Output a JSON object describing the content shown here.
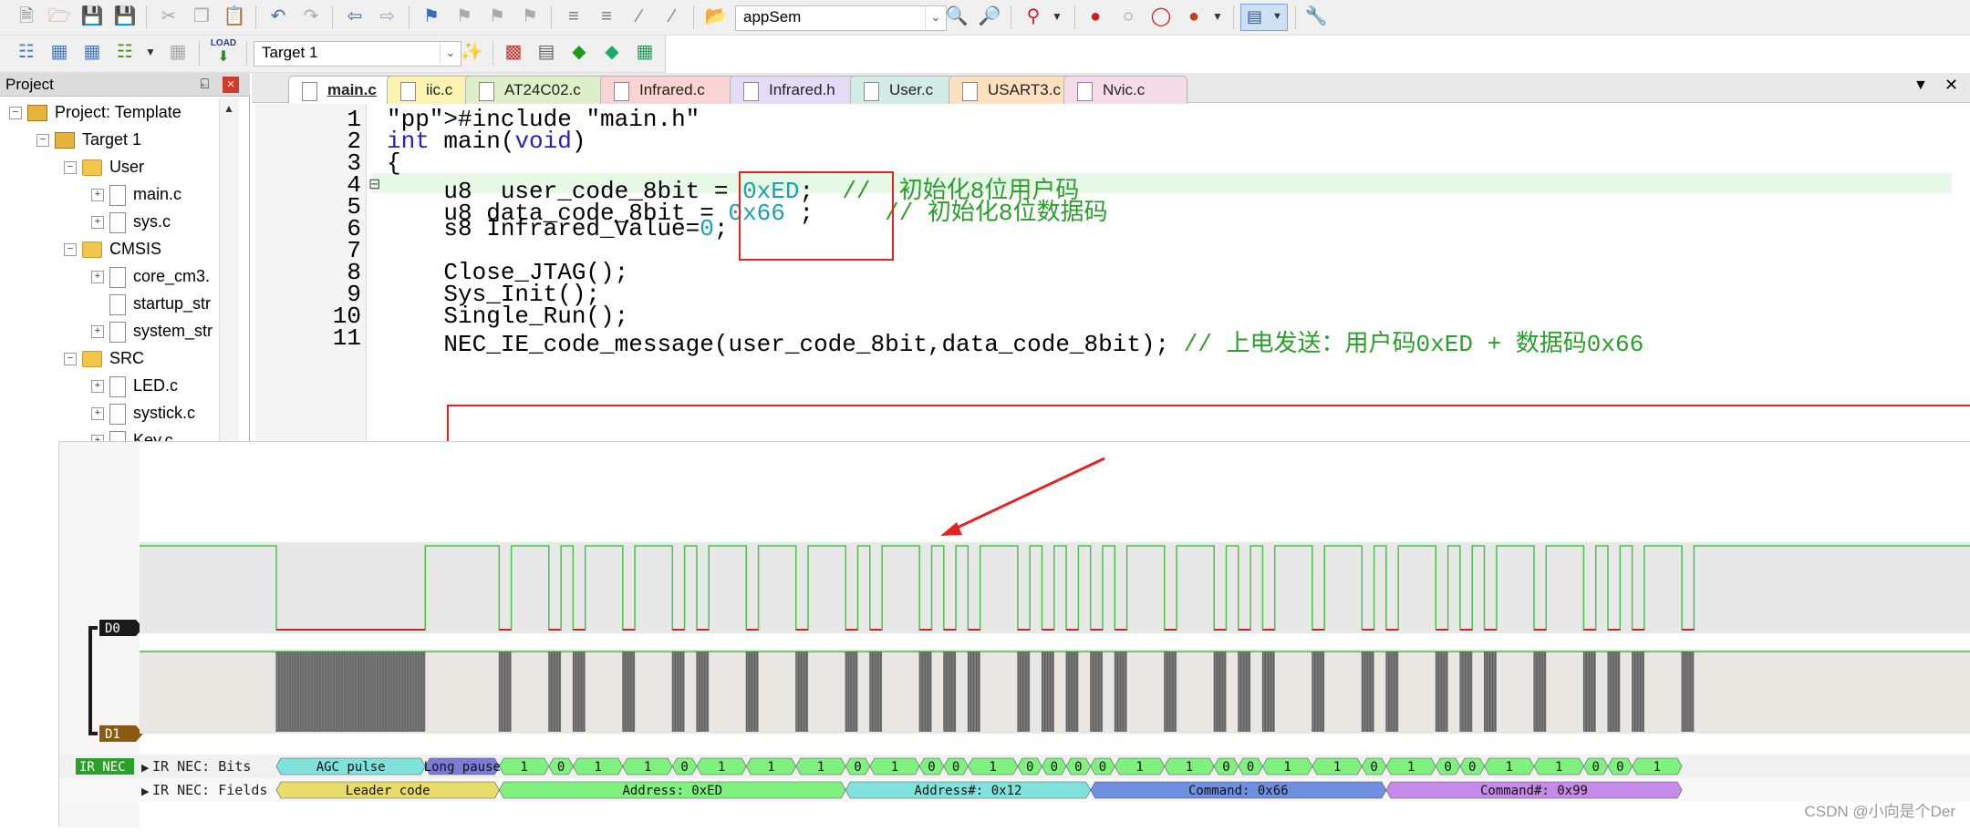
{
  "toolbar1": {
    "search_value": "appSem"
  },
  "toolbar2": {
    "target_value": "Target 1",
    "load_label": "LOAD"
  },
  "project": {
    "title": "Project",
    "pin": "⍇",
    "close": "×",
    "tree": [
      {
        "label": "Project: Template",
        "expander": "−",
        "icon": "project"
      },
      {
        "label": "Target 1",
        "expander": "−",
        "icon": "target"
      },
      {
        "label": "User",
        "expander": "−",
        "icon": "folder"
      },
      {
        "label": "main.c",
        "expander": "+",
        "icon": "file"
      },
      {
        "label": "sys.c",
        "expander": "+",
        "icon": "file"
      },
      {
        "label": "CMSIS",
        "expander": "−",
        "icon": "folder"
      },
      {
        "label": "core_cm3.",
        "expander": "+",
        "icon": "file"
      },
      {
        "label": "startup_str",
        "expander": "",
        "icon": "file"
      },
      {
        "label": "system_str",
        "expander": "+",
        "icon": "file"
      },
      {
        "label": "SRC",
        "expander": "−",
        "icon": "folder"
      },
      {
        "label": "LED.c",
        "expander": "+",
        "icon": "file"
      },
      {
        "label": "systick.c",
        "expander": "+",
        "icon": "file"
      },
      {
        "label": "Key.c",
        "expander": "+",
        "icon": "file"
      }
    ]
  },
  "tabs": [
    {
      "label": "main.c",
      "color": "#f6f6f6",
      "active": true
    },
    {
      "label": "iic.c",
      "color": "#fdf3b0"
    },
    {
      "label": "AT24C02.c",
      "color": "#dff0c8"
    },
    {
      "label": "Infrared.c",
      "color": "#fad4d4"
    },
    {
      "label": "Infrared.h",
      "color": "#e4dcf6"
    },
    {
      "label": "User.c",
      "color": "#d4ece6"
    },
    {
      "label": "USART3.c",
      "color": "#fde0c0"
    },
    {
      "label": "Nvic.c",
      "color": "#f6dbe8"
    }
  ],
  "tab_controls": {
    "dropdown": "▼",
    "close": "✕"
  },
  "code": {
    "line_numbers": [
      "1",
      "2",
      "3",
      "4",
      "5",
      "6",
      "7",
      "8",
      "9",
      "10",
      "11"
    ],
    "fold_marker": "⊟",
    "lines": [
      {
        "text": "#include \"main.h\""
      },
      {
        "text": "int main(void)"
      },
      {
        "text": "{"
      },
      {
        "text": "    u8  user_code_8bit = 0xED;  //  初始化8位用户码"
      },
      {
        "text": "    u8 data_code_8bit = 0x66 ;     // 初始化8位数据码"
      },
      {
        "text": "    s8 Infrared_Value=0;"
      },
      {
        "text": ""
      },
      {
        "text": "    Close_JTAG();"
      },
      {
        "text": "    Sys_Init();"
      },
      {
        "text": "    Single_Run();"
      },
      {
        "text": "    NEC_IE_code_message(user_code_8bit,data_code_8bit); // 上电发送：用户码0xED + 数据码0x66"
      }
    ]
  },
  "analyzer": {
    "channels": [
      {
        "label": "D0",
        "color": "#1a1a1a"
      },
      {
        "label": "D1",
        "color": "#8b5a12"
      }
    ],
    "decoder_label": "IR NEC",
    "row_bits_label": "IR NEC: Bits",
    "row_fields_label": "IR NEC: Fields",
    "bits_header": [
      {
        "label": "AGC pulse",
        "color": "#7fe3dc"
      },
      {
        "label": "Long pause",
        "color": "#7b7bd8"
      }
    ],
    "bits": [
      "1",
      "0",
      "1",
      "1",
      "0",
      "1",
      "1",
      "1",
      "0",
      "1",
      "0",
      "0",
      "1",
      "0",
      "0",
      "0",
      "0",
      "1",
      "1",
      "0",
      "0",
      "1",
      "1",
      "0",
      "1",
      "0",
      "0",
      "1",
      "1",
      "0",
      "0",
      "1"
    ],
    "bit_color": "#7ef17e",
    "fields": [
      {
        "label": "Leader code",
        "color": "#e8dc6a"
      },
      {
        "label": "Address: 0xED",
        "color": "#7ef17e"
      },
      {
        "label": "Address#: 0x12",
        "color": "#7fe3dc"
      },
      {
        "label": "Command: 0x66",
        "color": "#6f8fe0"
      },
      {
        "label": "Command#: 0x99",
        "color": "#c68ae8"
      }
    ]
  },
  "watermark": "CSDN @小向是个Der",
  "colors": {
    "annotation_red": "#e52222",
    "signal_green": "#49c449",
    "signal_red": "#c42a2a"
  }
}
